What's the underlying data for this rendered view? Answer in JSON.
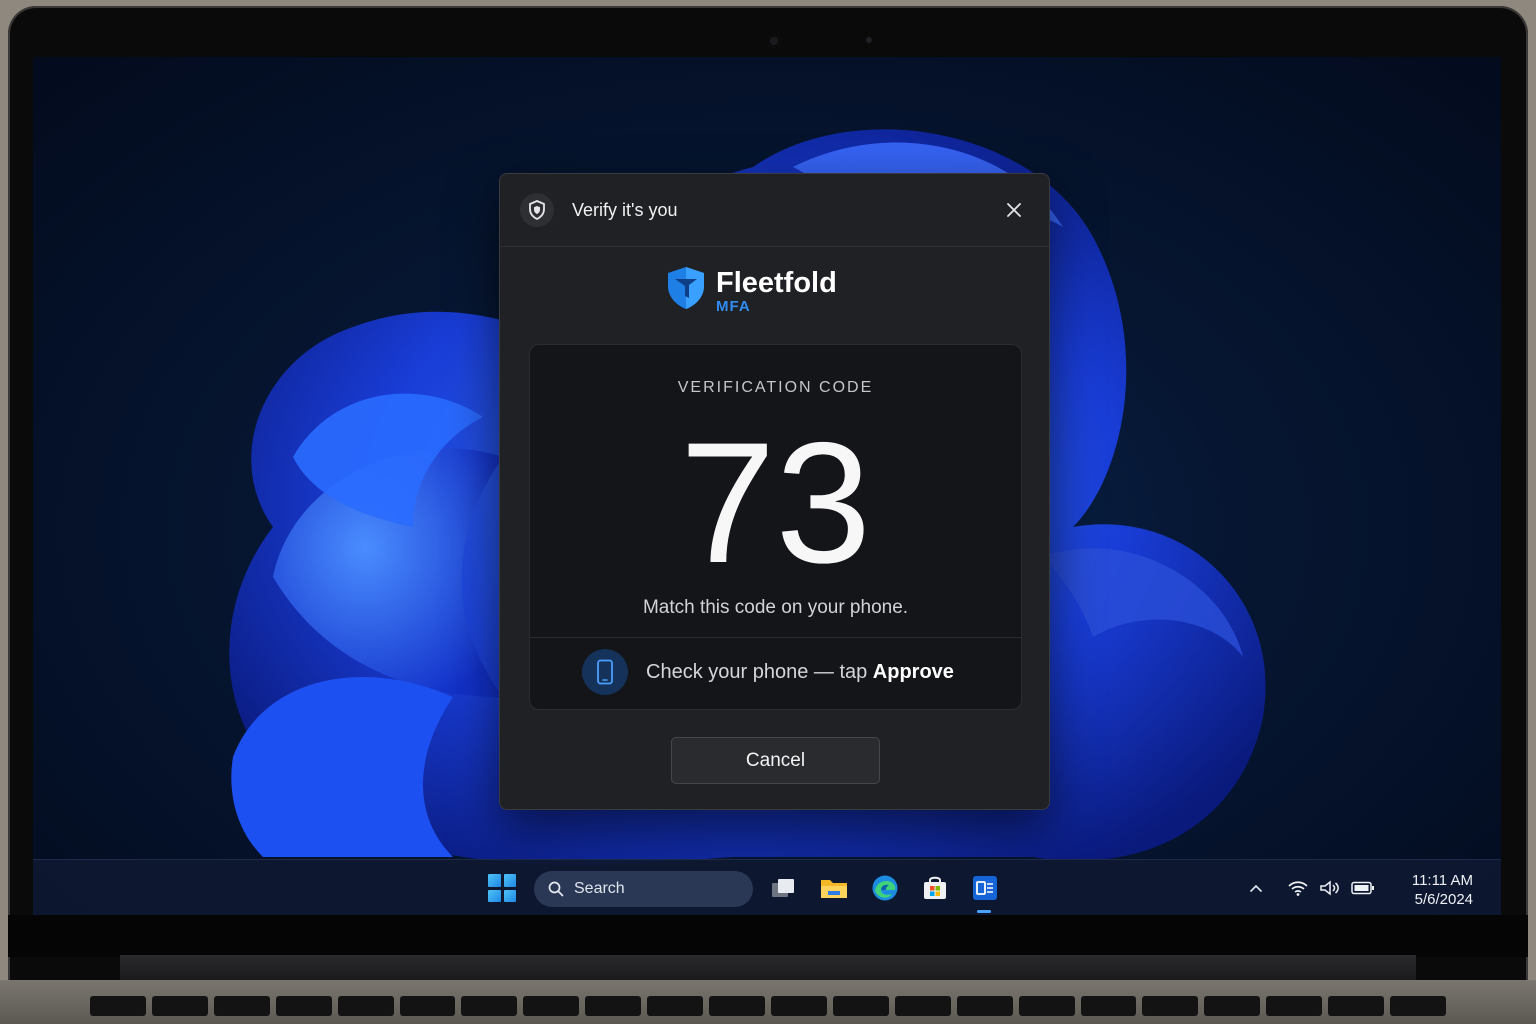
{
  "dialog": {
    "title": "Verify it's you",
    "brand_name": "Fleetfold",
    "brand_sub": "MFA",
    "code_label": "VERIFICATION CODE",
    "code": "73",
    "code_hint": "Match this code on your phone.",
    "phone_prompt_prefix": "Check your phone — tap ",
    "phone_prompt_action": "Approve",
    "cancel_label": "Cancel"
  },
  "taskbar": {
    "search_label": "Search",
    "apps": [
      "task-view-icon",
      "file-explorer-icon",
      "edge-icon",
      "store-icon",
      "mfa-app-icon"
    ],
    "clock_time": "11:11 AM",
    "clock_date": "5/6/2024"
  },
  "colors": {
    "accent": "#2f8cf2",
    "dialog_bg": "#202124",
    "card_bg": "#141519",
    "taskbar_bg": "#0e1830"
  }
}
